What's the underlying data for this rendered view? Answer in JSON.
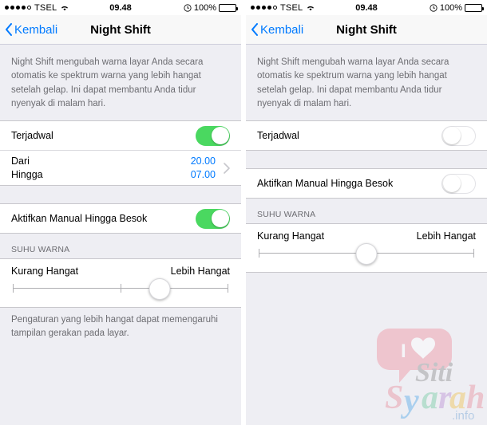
{
  "status_bar": {
    "carrier": "TSEL",
    "signal_dots_filled": 4,
    "signal_dots_total": 5,
    "wifi_icon": "wifi-icon",
    "time": "09.48",
    "alarm_icon": "alarm-clock-icon",
    "battery_percent": "100%",
    "battery_level": 100
  },
  "nav": {
    "back_label": "Kembali",
    "back_icon": "chevron-left-icon",
    "title": "Night Shift"
  },
  "description": "Night Shift mengubah warna layar Anda secara otomatis ke spektrum warna yang lebih hangat setelah gelap. Ini dapat membantu Anda tidur nyenyak di malam hari.",
  "screens": [
    {
      "id": "left",
      "scheduled": {
        "label": "Terjadwal",
        "enabled": true
      },
      "schedule_times": {
        "visible": true,
        "from_label": "Dari",
        "from_value": "20.00",
        "to_label": "Hingga",
        "to_value": "07.00",
        "disclosure_icon": "chevron-right-icon"
      },
      "manual": {
        "label": "Aktifkan Manual Hingga Besok",
        "enabled": true
      },
      "color_temp": {
        "section_header": "SUHU WARNA",
        "min_label": "Kurang Hangat",
        "max_label": "Lebih Hangat",
        "value_percent": 68,
        "ticks": [
          0,
          50,
          100
        ]
      },
      "footnote": "Pengaturan yang lebih hangat dapat memengaruhi tampilan gerakan pada layar."
    },
    {
      "id": "right",
      "scheduled": {
        "label": "Terjadwal",
        "enabled": false
      },
      "schedule_times": {
        "visible": false,
        "from_label": "Dari",
        "from_value": "",
        "to_label": "Hingga",
        "to_value": "",
        "disclosure_icon": "chevron-right-icon"
      },
      "manual": {
        "label": "Aktifkan Manual Hingga Besok",
        "enabled": false
      },
      "color_temp": {
        "section_header": "SUHU WARNA",
        "min_label": "Kurang Hangat",
        "max_label": "Lebih Hangat",
        "value_percent": 50,
        "ticks": [
          0,
          50,
          100
        ]
      },
      "footnote": ""
    }
  ],
  "watermark": {
    "heart_text": "I",
    "heart_icon": "heart-icon",
    "name_first": "Siti",
    "name_second": "Syarah",
    "suffix": ".info",
    "bubble_color": "#f08d9d",
    "colors": [
      "#e98b9b",
      "#4da6e8",
      "#6ec9a0",
      "#b98bd4",
      "#f0c04a",
      "#9a9a9a"
    ]
  },
  "theme": {
    "accent_blue": "#007aff",
    "toggle_on_green": "#4ad860",
    "page_background": "#eeeef3",
    "row_background": "#ffffff",
    "secondary_text": "#6d6d72"
  }
}
